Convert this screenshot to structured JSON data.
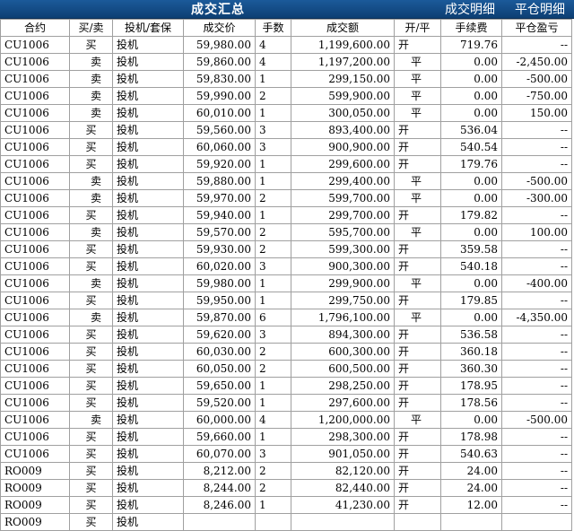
{
  "tabs": {
    "summary": "成交汇总",
    "detail": "成交明细",
    "close_detail": "平仓明细"
  },
  "columns": [
    "合约",
    "买/卖",
    "投机/套保",
    "成交价",
    "手数",
    "成交额",
    "开/平",
    "手续费",
    "平仓盈亏"
  ],
  "rows": [
    [
      "CU1006",
      "买",
      "投机",
      "59,980.00",
      "4",
      "1,199,600.00",
      "开",
      "719.76",
      "--"
    ],
    [
      "CU1006",
      "卖",
      "投机",
      "59,860.00",
      "4",
      "1,197,200.00",
      "平",
      "0.00",
      "-2,450.00"
    ],
    [
      "CU1006",
      "卖",
      "投机",
      "59,830.00",
      "1",
      "299,150.00",
      "平",
      "0.00",
      "-500.00"
    ],
    [
      "CU1006",
      "卖",
      "投机",
      "59,990.00",
      "2",
      "599,900.00",
      "平",
      "0.00",
      "-750.00"
    ],
    [
      "CU1006",
      "卖",
      "投机",
      "60,010.00",
      "1",
      "300,050.00",
      "平",
      "0.00",
      "150.00"
    ],
    [
      "CU1006",
      "买",
      "投机",
      "59,560.00",
      "3",
      "893,400.00",
      "开",
      "536.04",
      "--"
    ],
    [
      "CU1006",
      "买",
      "投机",
      "60,060.00",
      "3",
      "900,900.00",
      "开",
      "540.54",
      "--"
    ],
    [
      "CU1006",
      "买",
      "投机",
      "59,920.00",
      "1",
      "299,600.00",
      "开",
      "179.76",
      "--"
    ],
    [
      "CU1006",
      "卖",
      "投机",
      "59,880.00",
      "1",
      "299,400.00",
      "平",
      "0.00",
      "-500.00"
    ],
    [
      "CU1006",
      "卖",
      "投机",
      "59,970.00",
      "2",
      "599,700.00",
      "平",
      "0.00",
      "-300.00"
    ],
    [
      "CU1006",
      "买",
      "投机",
      "59,940.00",
      "1",
      "299,700.00",
      "开",
      "179.82",
      "--"
    ],
    [
      "CU1006",
      "卖",
      "投机",
      "59,570.00",
      "2",
      "595,700.00",
      "平",
      "0.00",
      "100.00"
    ],
    [
      "CU1006",
      "买",
      "投机",
      "59,930.00",
      "2",
      "599,300.00",
      "开",
      "359.58",
      "--"
    ],
    [
      "CU1006",
      "买",
      "投机",
      "60,020.00",
      "3",
      "900,300.00",
      "开",
      "540.18",
      "--"
    ],
    [
      "CU1006",
      "卖",
      "投机",
      "59,980.00",
      "1",
      "299,900.00",
      "平",
      "0.00",
      "-400.00"
    ],
    [
      "CU1006",
      "买",
      "投机",
      "59,950.00",
      "1",
      "299,750.00",
      "开",
      "179.85",
      "--"
    ],
    [
      "CU1006",
      "卖",
      "投机",
      "59,870.00",
      "6",
      "1,796,100.00",
      "平",
      "0.00",
      "-4,350.00"
    ],
    [
      "CU1006",
      "买",
      "投机",
      "59,620.00",
      "3",
      "894,300.00",
      "开",
      "536.58",
      "--"
    ],
    [
      "CU1006",
      "买",
      "投机",
      "60,030.00",
      "2",
      "600,300.00",
      "开",
      "360.18",
      "--"
    ],
    [
      "CU1006",
      "买",
      "投机",
      "60,050.00",
      "2",
      "600,500.00",
      "开",
      "360.30",
      "--"
    ],
    [
      "CU1006",
      "买",
      "投机",
      "59,650.00",
      "1",
      "298,250.00",
      "开",
      "178.95",
      "--"
    ],
    [
      "CU1006",
      "买",
      "投机",
      "59,520.00",
      "1",
      "297,600.00",
      "开",
      "178.56",
      "--"
    ],
    [
      "CU1006",
      "卖",
      "投机",
      "60,000.00",
      "4",
      "1,200,000.00",
      "平",
      "0.00",
      "-500.00"
    ],
    [
      "CU1006",
      "买",
      "投机",
      "59,660.00",
      "1",
      "298,300.00",
      "开",
      "178.98",
      "--"
    ],
    [
      "CU1006",
      "买",
      "投机",
      "60,070.00",
      "3",
      "901,050.00",
      "开",
      "540.63",
      "--"
    ],
    [
      "RO009",
      "买",
      "投机",
      "8,212.00",
      "2",
      "82,120.00",
      "开",
      "24.00",
      "--"
    ],
    [
      "RO009",
      "买",
      "投机",
      "8,244.00",
      "2",
      "82,440.00",
      "开",
      "24.00",
      "--"
    ],
    [
      "RO009",
      "买",
      "投机",
      "8,246.00",
      "1",
      "41,230.00",
      "开",
      "12.00",
      "--"
    ],
    [
      "RO009",
      "买",
      "投机",
      "",
      "",
      "",
      "",
      "",
      ""
    ]
  ]
}
